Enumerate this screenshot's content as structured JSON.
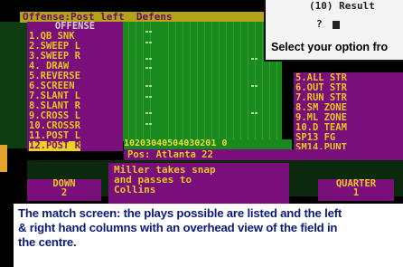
{
  "header": {
    "text": "Offense:Post left  Defens"
  },
  "left_column": {
    "title": "OFFENSE",
    "plays": [
      "1.QB SNK",
      "2.SWEEP L",
      "3.SWEEP R",
      "4. DRAW",
      "5.REVERSE",
      "6.SCREEN",
      "7.SLANT L",
      "8.SLANT R",
      "9.CROSS L",
      "10.CROSSR",
      "11.POST L",
      "12.POST R"
    ],
    "selected_index": 11
  },
  "right_column": {
    "plays": [
      "5.ALL STR",
      "6.OUT STR",
      "7.RUN STR",
      "8.SM ZONE",
      "9.ML ZONE",
      "10.D TEAM",
      "SP13 FG",
      "SM14.PUNT"
    ]
  },
  "field": {
    "yard_numbers": "10203040504030201 0"
  },
  "pos_bar": {
    "text": "Pos: Atlanta 22"
  },
  "down": {
    "label": "DOWN",
    "value": "2"
  },
  "quarter": {
    "label": "QUARTER",
    "value": "1"
  },
  "message": {
    "lines": [
      "Miller takes snap",
      "and passes to",
      "Collins"
    ]
  },
  "popup": {
    "results": "(10) Result",
    "prompt": "?",
    "select": "Select your option fro"
  },
  "caption": {
    "lines": [
      "The match screen: the plays possible are listed and the left",
      "& right hand columns with an overhead view of the field in",
      "the centre."
    ]
  },
  "colors": {
    "purple": "#7a0e7a",
    "yellow": "#e5c820",
    "field_green": "#1a8a1f",
    "caption_blue": "#0a1b7a"
  }
}
